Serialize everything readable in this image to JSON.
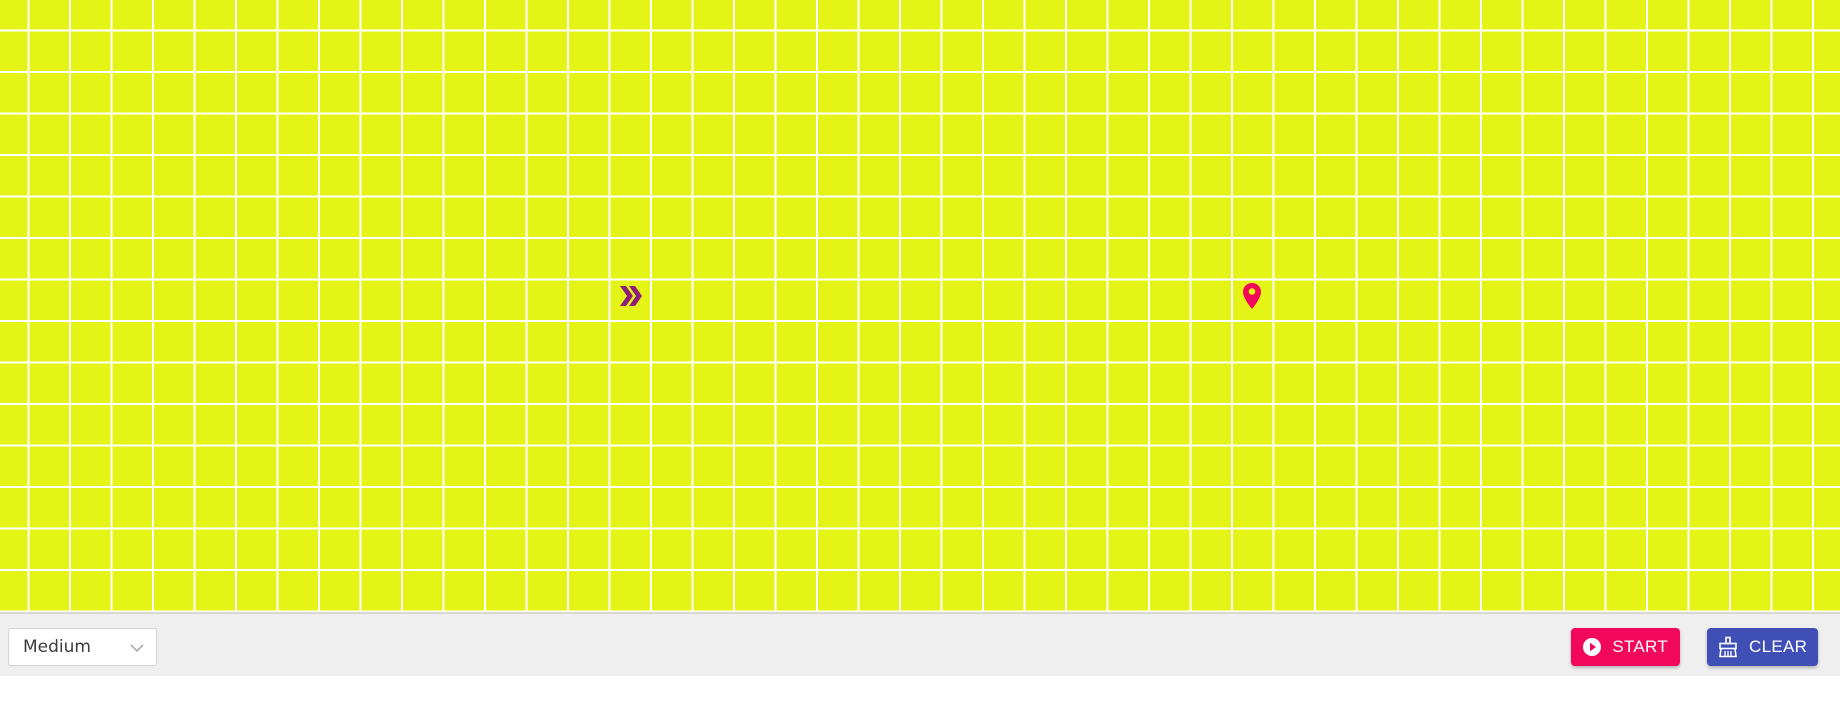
{
  "grid": {
    "background_color": "#e3f416",
    "line_color": "#ffffff",
    "start_icon": "double-chevron-right-icon",
    "start_icon_color": "#8e1f7a",
    "target_icon": "map-pin-icon",
    "target_icon_color": "#f2085b"
  },
  "toolbar": {
    "speed_select": {
      "value": "Medium",
      "icon": "chevron-down-icon"
    },
    "start_button": {
      "label": "START",
      "icon": "play-circle-icon",
      "color": "#f2085b"
    },
    "clear_button": {
      "label": "CLEAR",
      "icon": "broom-icon",
      "color": "#3f4fb5"
    }
  }
}
